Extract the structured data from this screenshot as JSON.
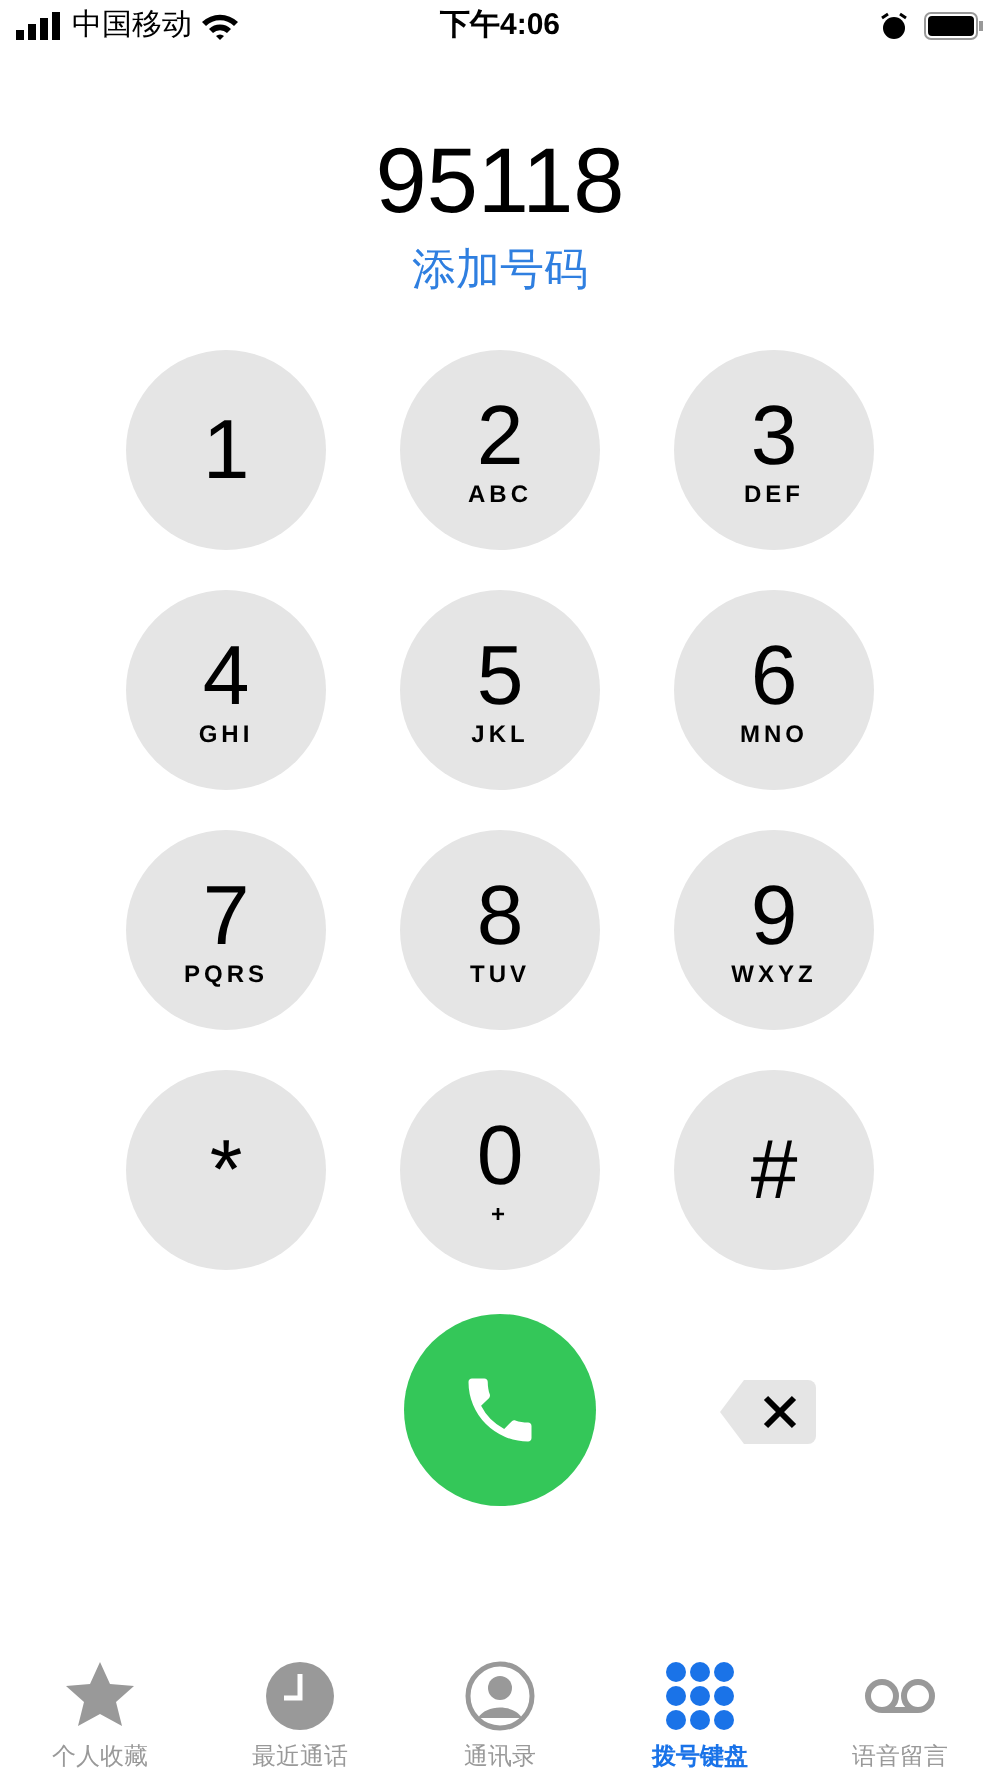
{
  "status_bar": {
    "carrier": "中国移动",
    "time": "下午4:06"
  },
  "number": "95118",
  "add_number": "添加号码",
  "keys": [
    {
      "digit": "1"
    },
    {
      "digit": "2",
      "letters": "ABC"
    },
    {
      "digit": "3",
      "letters": "DEF"
    },
    {
      "digit": "4",
      "letters": "GHI"
    },
    {
      "digit": "5",
      "letters": "JKL"
    },
    {
      "digit": "6",
      "letters": "MNO"
    },
    {
      "digit": "7",
      "letters": "PQRS"
    },
    {
      "digit": "8",
      "letters": "TUV"
    },
    {
      "digit": "9",
      "letters": "WXYZ"
    },
    {
      "digit": "*"
    },
    {
      "digit": "0",
      "letters": "+"
    },
    {
      "digit": "#"
    }
  ],
  "tabs": [
    {
      "kind": "star",
      "label": "个人收藏",
      "selected": false
    },
    {
      "kind": "clock",
      "label": "最近通话",
      "selected": false
    },
    {
      "kind": "contact",
      "label": "通讯录",
      "selected": false
    },
    {
      "kind": "keypad",
      "label": "拨号键盘",
      "selected": true
    },
    {
      "kind": "voicemail",
      "label": "语音留言",
      "selected": false
    }
  ]
}
